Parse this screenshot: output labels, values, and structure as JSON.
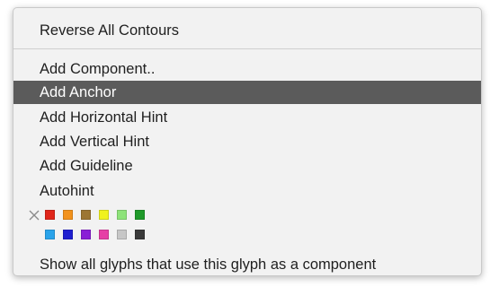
{
  "menu": {
    "items": [
      {
        "label": "Reverse All Contours"
      },
      {
        "label": "Add Component.."
      },
      {
        "label": "Add Anchor"
      },
      {
        "label": "Add Horizontal Hint"
      },
      {
        "label": "Add Vertical Hint"
      },
      {
        "label": "Add Guideline"
      },
      {
        "label": "Autohint"
      },
      {
        "label": "Show all glyphs that use this glyph as a component"
      }
    ],
    "highlighted_item": "Add Anchor",
    "color_labels": {
      "clear_icon": "x-icon",
      "row1": [
        "#e0261a",
        "#f2921c",
        "#9c7634",
        "#f0f21e",
        "#8ee37a",
        "#1f9a2a"
      ],
      "row2": [
        "#2aa3ea",
        "#1f1fd0",
        "#8a1fd6",
        "#e63fa6",
        "#c6c6c6",
        "#3a3a3a"
      ]
    }
  },
  "colors": {
    "menu_background": "#f2f2f2",
    "highlight_background": "#5b5b5b",
    "highlight_text": "#ffffff",
    "text": "#1f1f1f"
  }
}
